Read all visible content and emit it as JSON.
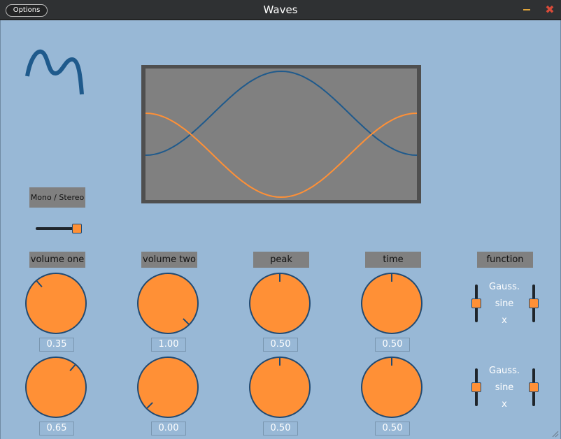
{
  "window": {
    "title": "Waves",
    "options_label": "Options",
    "minimize_glyph": "—",
    "close_glyph": "✖"
  },
  "colors": {
    "background": "#98b8d6",
    "titlebar": "#2f3133",
    "knob_fill": "#ff9036",
    "knob_outline": "#214a72",
    "wave_one": "#1f5a8c",
    "wave_two": "#ff9036",
    "scope_bg": "#808080",
    "scope_frame": "#4f4f4f"
  },
  "logo_icon": "wave-logo-icon",
  "mode_button": {
    "label": "Mono / Stereo",
    "slider_value": 1
  },
  "columns": [
    {
      "label": "volume one",
      "knobs": [
        {
          "value": "0.35"
        },
        {
          "value": "0.65"
        }
      ]
    },
    {
      "label": "volume two",
      "knobs": [
        {
          "value": "1.00"
        },
        {
          "value": "0.00"
        }
      ]
    },
    {
      "label": "peak",
      "knobs": [
        {
          "value": "0.50"
        },
        {
          "value": "0.50"
        }
      ]
    },
    {
      "label": "time",
      "knobs": [
        {
          "value": "0.50"
        },
        {
          "value": "0.50"
        }
      ]
    }
  ],
  "function_panel": {
    "label": "function",
    "rows": [
      {
        "line1": "Gauss.",
        "line2": "sine",
        "line3": "x",
        "left_slider": 0.5,
        "right_slider": 0.5
      },
      {
        "line1": "Gauss.",
        "line2": "sine",
        "line3": "x",
        "left_slider": 0.5,
        "right_slider": 0.5
      }
    ]
  }
}
